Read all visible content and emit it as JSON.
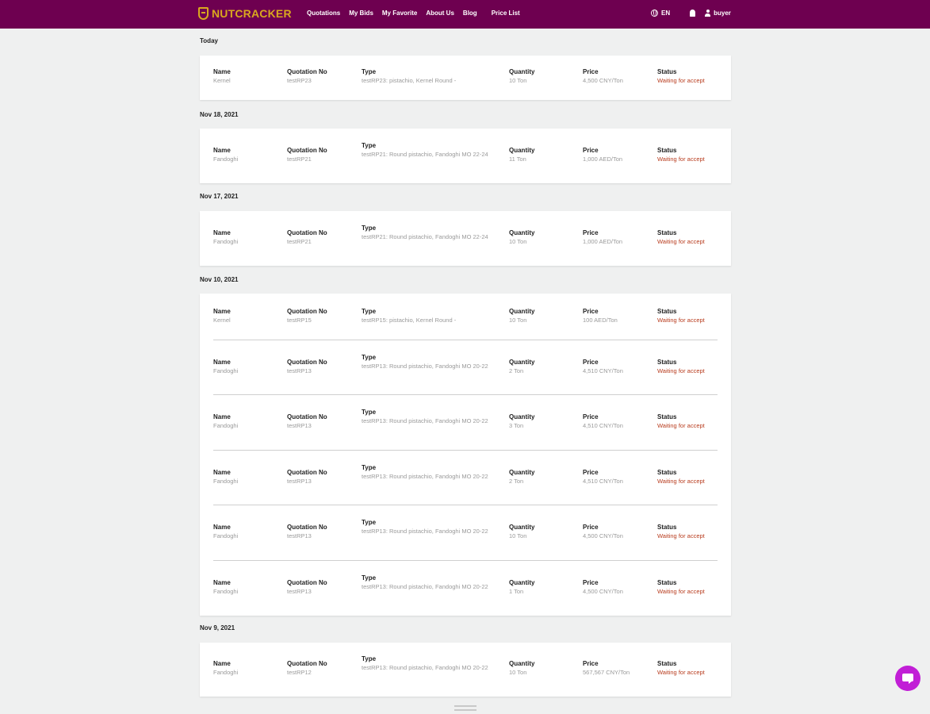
{
  "nav": {
    "logo_text": "NUTCRACKER",
    "menu": [
      "Quotations",
      "My Bids",
      "My Favorite",
      "About Us",
      "Blog",
      "Price List"
    ],
    "language": "EN",
    "user": "buyer",
    "bg_color": "#6e0050",
    "logo_color": "#d9a81e"
  },
  "labels": {
    "name": "Name",
    "quotation_no": "Quotation No",
    "type": "Type",
    "quantity": "Quantity",
    "price": "Price",
    "status": "Status"
  },
  "groups": [
    {
      "date": "Today",
      "items": [
        {
          "name": "Kernel",
          "quotation_no": "testRP23",
          "type": "testRP23: pistachio, Kernel Round -",
          "quantity": "10 Ton",
          "price": "4,500 CNY/Ton",
          "status": "Waiting for accept"
        }
      ]
    },
    {
      "date": "Nov 18, 2021",
      "items": [
        {
          "name": "Fandoghi",
          "quotation_no": "testRP21",
          "type": "testRP21: Round pistachio, Fandoghi MO 22-24",
          "quantity": "11 Ton",
          "price": "1,000 AED/Ton",
          "status": "Waiting for accept"
        }
      ]
    },
    {
      "date": "Nov 17, 2021",
      "items": [
        {
          "name": "Fandoghi",
          "quotation_no": "testRP21",
          "type": "testRP21: Round pistachio, Fandoghi MO 22-24",
          "quantity": "10 Ton",
          "price": "1,000 AED/Ton",
          "status": "Waiting for accept"
        }
      ]
    },
    {
      "date": "Nov 10, 2021",
      "items": [
        {
          "name": "Kernel",
          "quotation_no": "testRP15",
          "type": "testRP15: pistachio, Kernel Round -",
          "quantity": "10 Ton",
          "price": "100 AED/Ton",
          "status": "Waiting for accept"
        },
        {
          "name": "Fandoghi",
          "quotation_no": "testRP13",
          "type": "testRP13: Round pistachio, Fandoghi MO 20-22",
          "quantity": "2 Ton",
          "price": "4,510 CNY/Ton",
          "status": "Waiting for accept"
        },
        {
          "name": "Fandoghi",
          "quotation_no": "testRP13",
          "type": "testRP13: Round pistachio, Fandoghi MO 20-22",
          "quantity": "3 Ton",
          "price": "4,510 CNY/Ton",
          "status": "Waiting for accept"
        },
        {
          "name": "Fandoghi",
          "quotation_no": "testRP13",
          "type": "testRP13: Round pistachio, Fandoghi MO 20-22",
          "quantity": "2 Ton",
          "price": "4,510 CNY/Ton",
          "status": "Waiting for accept"
        },
        {
          "name": "Fandoghi",
          "quotation_no": "testRP13",
          "type": "testRP13: Round pistachio, Fandoghi MO 20-22",
          "quantity": "10 Ton",
          "price": "4,500 CNY/Ton",
          "status": "Waiting for accept"
        },
        {
          "name": "Fandoghi",
          "quotation_no": "testRP13",
          "type": "testRP13: Round pistachio, Fandoghi MO 20-22",
          "quantity": "1 Ton",
          "price": "4,500 CNY/Ton",
          "status": "Waiting for accept"
        }
      ]
    },
    {
      "date": "Nov 9, 2021",
      "items": [
        {
          "name": "Fandoghi",
          "quotation_no": "testRP12",
          "type": "testRP13: Round pistachio, Fandoghi MO 20-22",
          "quantity": "10 Ton",
          "price": "567,567 CNY/Ton",
          "status": "Waiting for accept"
        }
      ]
    }
  ]
}
